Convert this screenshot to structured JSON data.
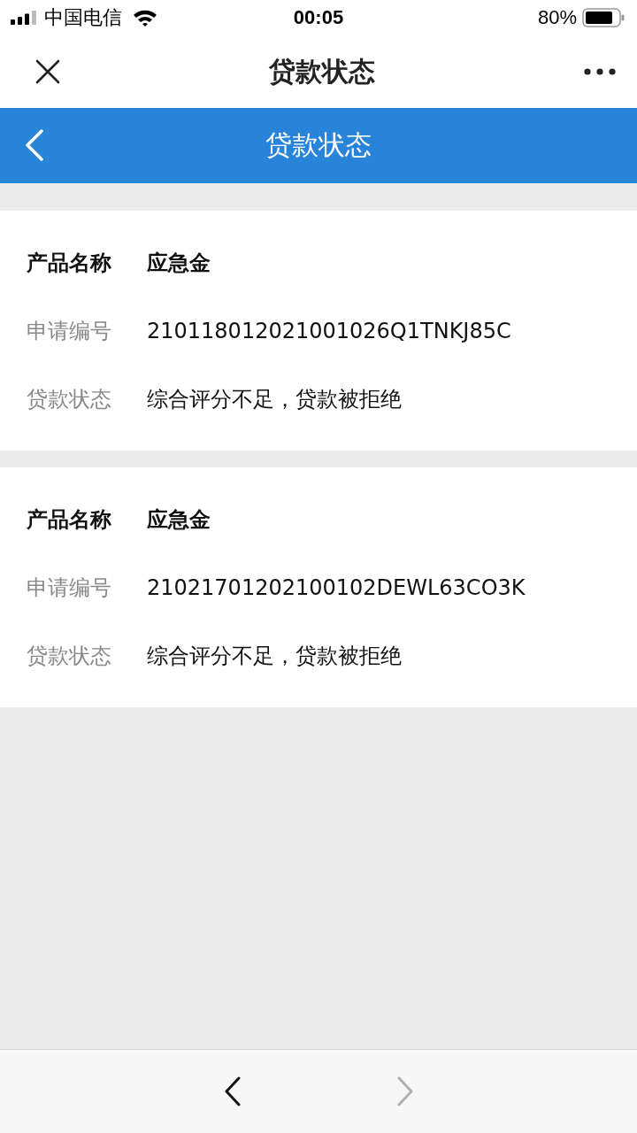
{
  "status_bar": {
    "carrier": "中国电信",
    "time": "00:05",
    "battery": "80%"
  },
  "nav_bar": {
    "title": "贷款状态"
  },
  "header": {
    "title": "贷款状态"
  },
  "loans": [
    {
      "fields": [
        {
          "kind": "title",
          "label": "产品名称",
          "value": "应急金"
        },
        {
          "kind": "detail",
          "label": "申请编号",
          "value": "210118012021001026Q1TNKJ85C"
        },
        {
          "kind": "detail",
          "label": "贷款状态",
          "value": "综合评分不足，贷款被拒绝"
        }
      ]
    },
    {
      "fields": [
        {
          "kind": "title",
          "label": "产品名称",
          "value": "应急金"
        },
        {
          "kind": "detail",
          "label": "申请编号",
          "value": "21021701202100102DEWL63CO3K"
        },
        {
          "kind": "detail",
          "label": "贷款状态",
          "value": "综合评分不足，贷款被拒绝"
        }
      ]
    }
  ],
  "toolbar": {
    "back": {
      "disabled": false
    },
    "forward": {
      "disabled": true
    }
  }
}
